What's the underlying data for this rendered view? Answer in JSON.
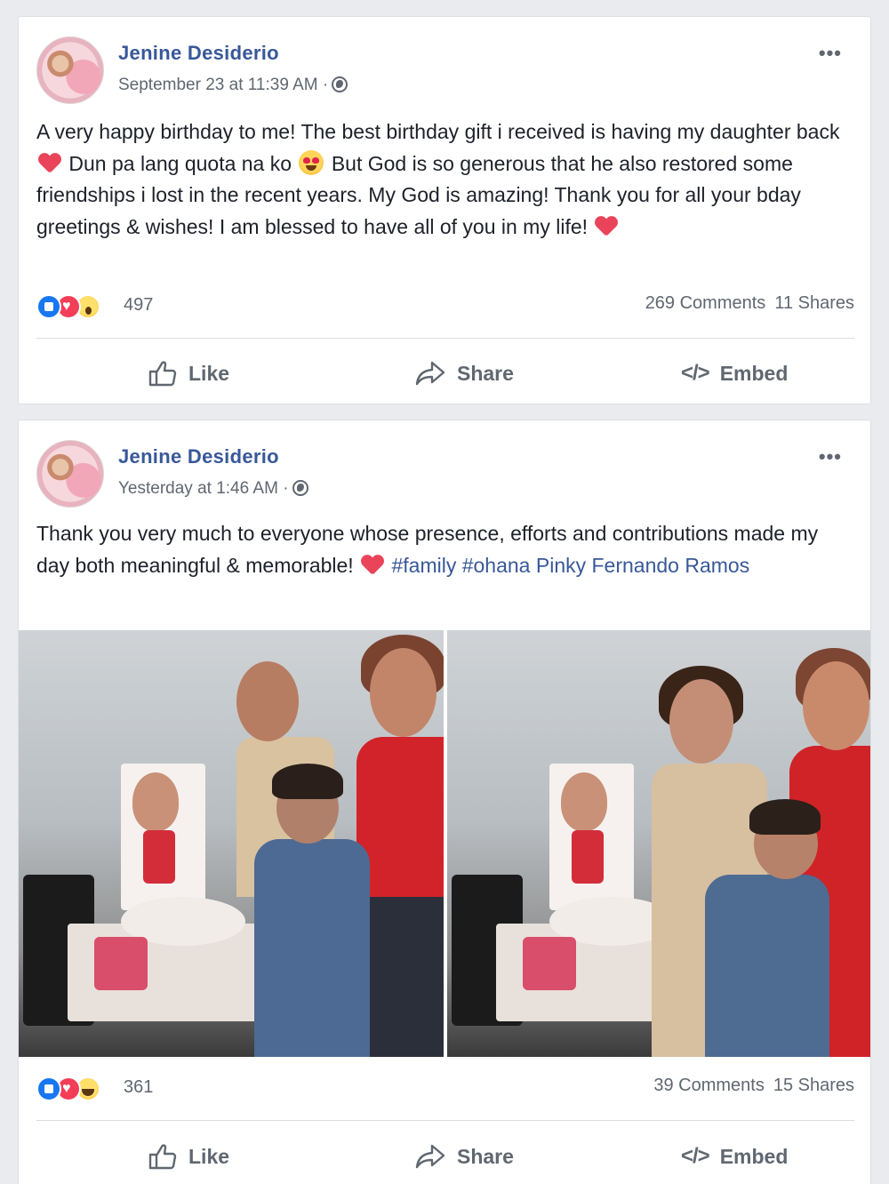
{
  "posts": [
    {
      "author": "Jenine Desiderio",
      "timestamp": "September 23 at 11:39 AM ·",
      "text_parts": [
        "A very happy birthday to me! The best birthday gift i received is having my daughter back",
        "Dun pa lang quota na ko",
        "But God is so generous that he also restored some friendships i lost in the recent years. My God is amazing! Thank you for all your bday greetings & wishes! I am blessed to have all of you in my life!"
      ],
      "reaction_count": "497",
      "comments": "269 Comments",
      "shares": "11 Shares",
      "reactions": [
        "like",
        "love",
        "wow"
      ]
    },
    {
      "author": "Jenine Desiderio",
      "timestamp": "Yesterday at 1:46 AM ·",
      "text": "Thank you very much to everyone whose presence, efforts and contributions made my day both meaningful & memorable!",
      "hashtags": "#family #ohana",
      "tagged": "Pinky Fernando Ramos",
      "reaction_count": "361",
      "comments": "39 Comments",
      "shares": "15 Shares",
      "reactions": [
        "like",
        "love",
        "haha"
      ]
    }
  ],
  "actions": {
    "like": "Like",
    "share": "Share",
    "embed": "Embed",
    "embed_glyph": "</>"
  },
  "more_glyph": "•••",
  "colors": {
    "link": "#385898",
    "heart": "#e9445a",
    "like_blue": "#1877f2"
  }
}
